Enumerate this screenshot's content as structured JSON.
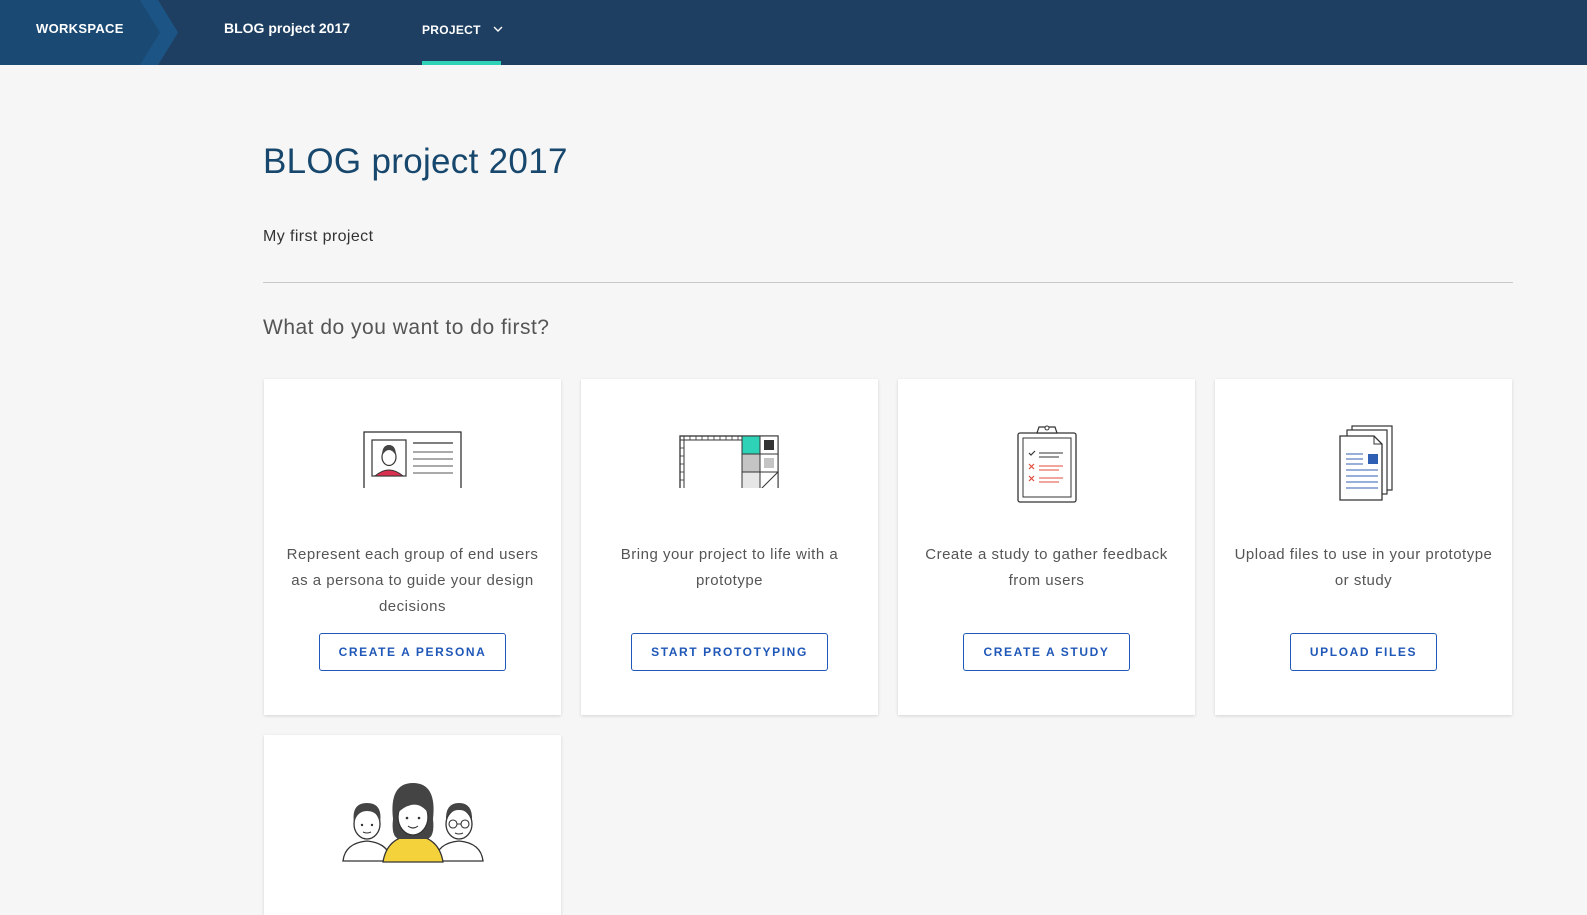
{
  "nav": {
    "workspace_label": "WORKSPACE",
    "project_name": "BLOG project 2017",
    "project_menu_label": "PROJECT"
  },
  "page": {
    "title": "BLOG project 2017",
    "description": "My first project",
    "question": "What do you want to do first?"
  },
  "cards": [
    {
      "description": "Represent each group of end users as a persona to guide your design decisions",
      "button": "CREATE A PERSONA",
      "icon": "persona-card-icon"
    },
    {
      "description": "Bring your project to life with a prototype",
      "button": "START PROTOTYPING",
      "icon": "prototype-canvas-icon"
    },
    {
      "description": "Create a study to gather feedback from users",
      "button": "CREATE A STUDY",
      "icon": "clipboard-checklist-icon"
    },
    {
      "description": "Upload files to use in your prototype or study",
      "button": "UPLOAD FILES",
      "icon": "documents-icon"
    },
    {
      "description": "",
      "button": "",
      "icon": "team-people-icon"
    }
  ],
  "colors": {
    "topbar": "#1e3f61",
    "accent_underline": "#2ed3b7",
    "title": "#17476c",
    "button": "#1f58b8",
    "page_bg": "#f6f6f6"
  }
}
